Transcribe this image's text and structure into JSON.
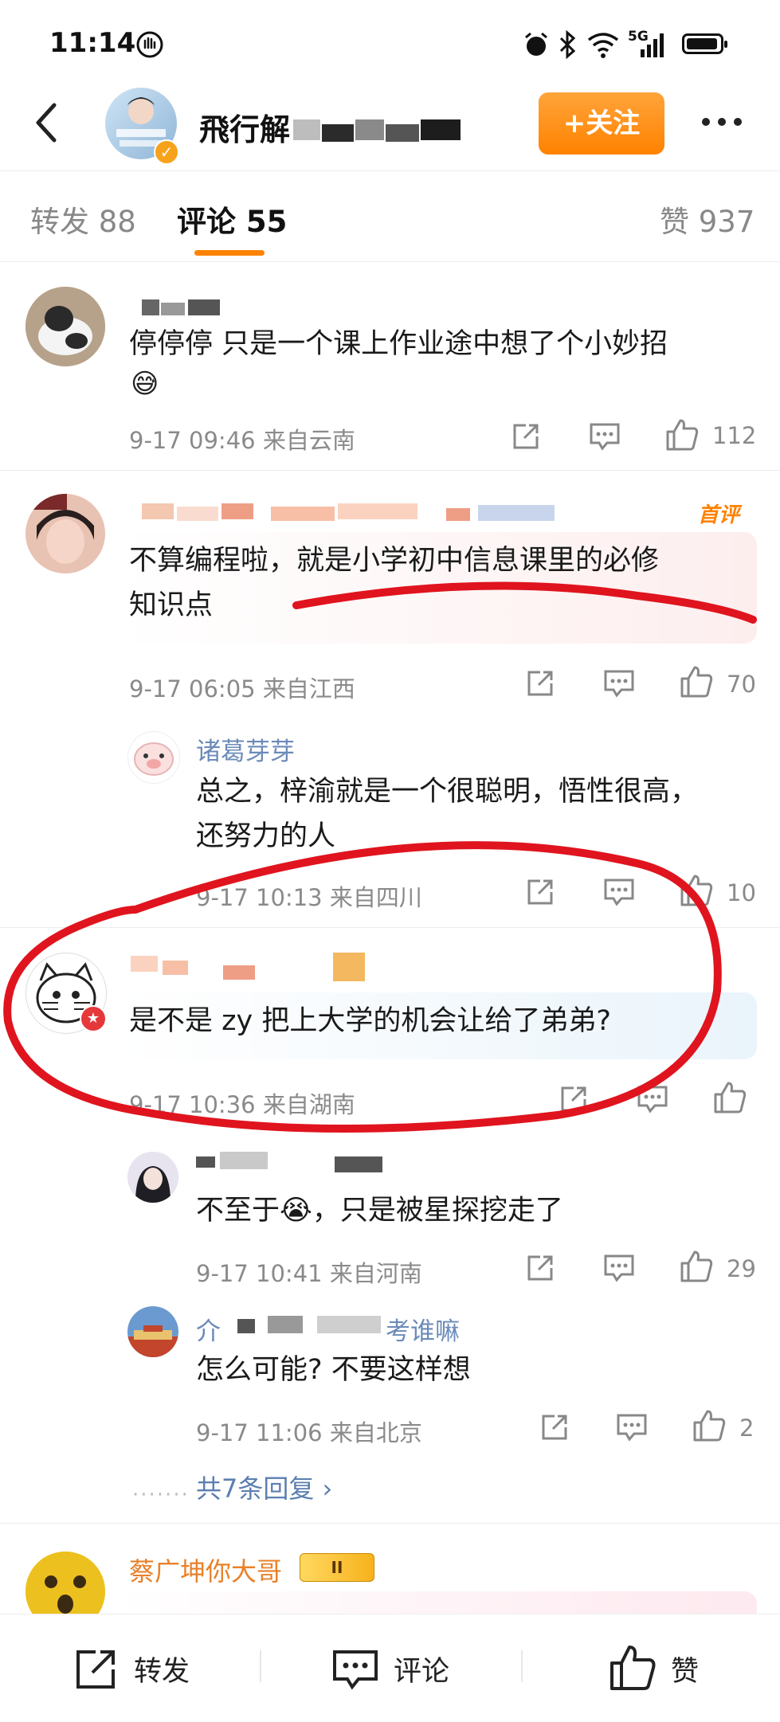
{
  "status": {
    "time": "11:14",
    "network": "5G"
  },
  "header": {
    "name": "飛行解",
    "follow_label": "+关注",
    "more_label": "•••"
  },
  "tabs": [
    {
      "label": "转发 88"
    },
    {
      "label": "评论 55"
    },
    {
      "label": "赞 937"
    }
  ],
  "comments": [
    {
      "text": "停停停 只是一个课上作业途中想了个小妙招",
      "time": "9-17 09:46 来自云南",
      "likes": "112"
    },
    {
      "badge": "首评",
      "text_line1": "不算编程啦，就是小学初中信息课里的必修",
      "text_line2": "知识点",
      "time": "9-17 06:05 来自江西",
      "likes": "70"
    }
  ],
  "reply1": {
    "name": "诸葛芽芽",
    "text_line1": "总之，梓渝就是一个很聪明，悟性很高，",
    "text_line2": "还努力的人",
    "time": "9-17 10:13 来自四川",
    "likes": "10"
  },
  "comment3": {
    "text": "是不是 zy 把上大学的机会让给了弟弟?",
    "time": "9-17 10:36 来自湖南"
  },
  "replies3": [
    {
      "text": "不至于😭，只是被星探挖走了",
      "time": "9-17 10:41 来自河南",
      "likes": "29"
    },
    {
      "name_prefix": "介",
      "name_suffix": "考谁嘛",
      "text": "怎么可能? 不要这样想",
      "time": "9-17 11:06 来自北京",
      "likes": "2"
    }
  ],
  "more_replies": "共7条回复 ›",
  "comment4": {
    "name": "蔡广坤你大哥",
    "level": "II"
  },
  "bottom": {
    "forward": "转发",
    "comment": "评论",
    "like": "赞"
  },
  "colors": {
    "accent": "#ff8200",
    "username": "#6b8bb8",
    "annotation": "#e0141e"
  }
}
